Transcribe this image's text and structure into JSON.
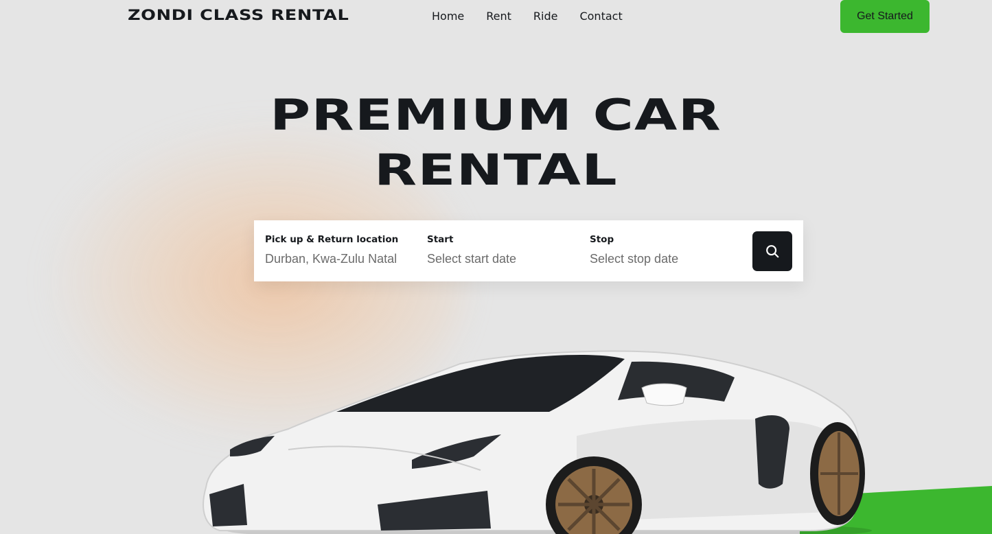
{
  "brand": {
    "name": "ZONDI CLASS RENTAL"
  },
  "nav": {
    "items": [
      "Home",
      "Rent",
      "Ride",
      "Contact"
    ]
  },
  "header": {
    "cta_label": "Get Started"
  },
  "hero": {
    "title_line1": "PREMIUM CAR",
    "title_line2": "RENTAL"
  },
  "search": {
    "location": {
      "label": "Pick up & Return location",
      "value": "Durban, Kwa-Zulu Natal"
    },
    "start": {
      "label": "Start",
      "placeholder": "Select start date"
    },
    "stop": {
      "label": "Stop",
      "placeholder": "Select stop date"
    },
    "button_icon": "search-icon"
  },
  "colors": {
    "accent": "#3cb72f",
    "dark": "#16191d",
    "background": "#e5e5e5"
  }
}
